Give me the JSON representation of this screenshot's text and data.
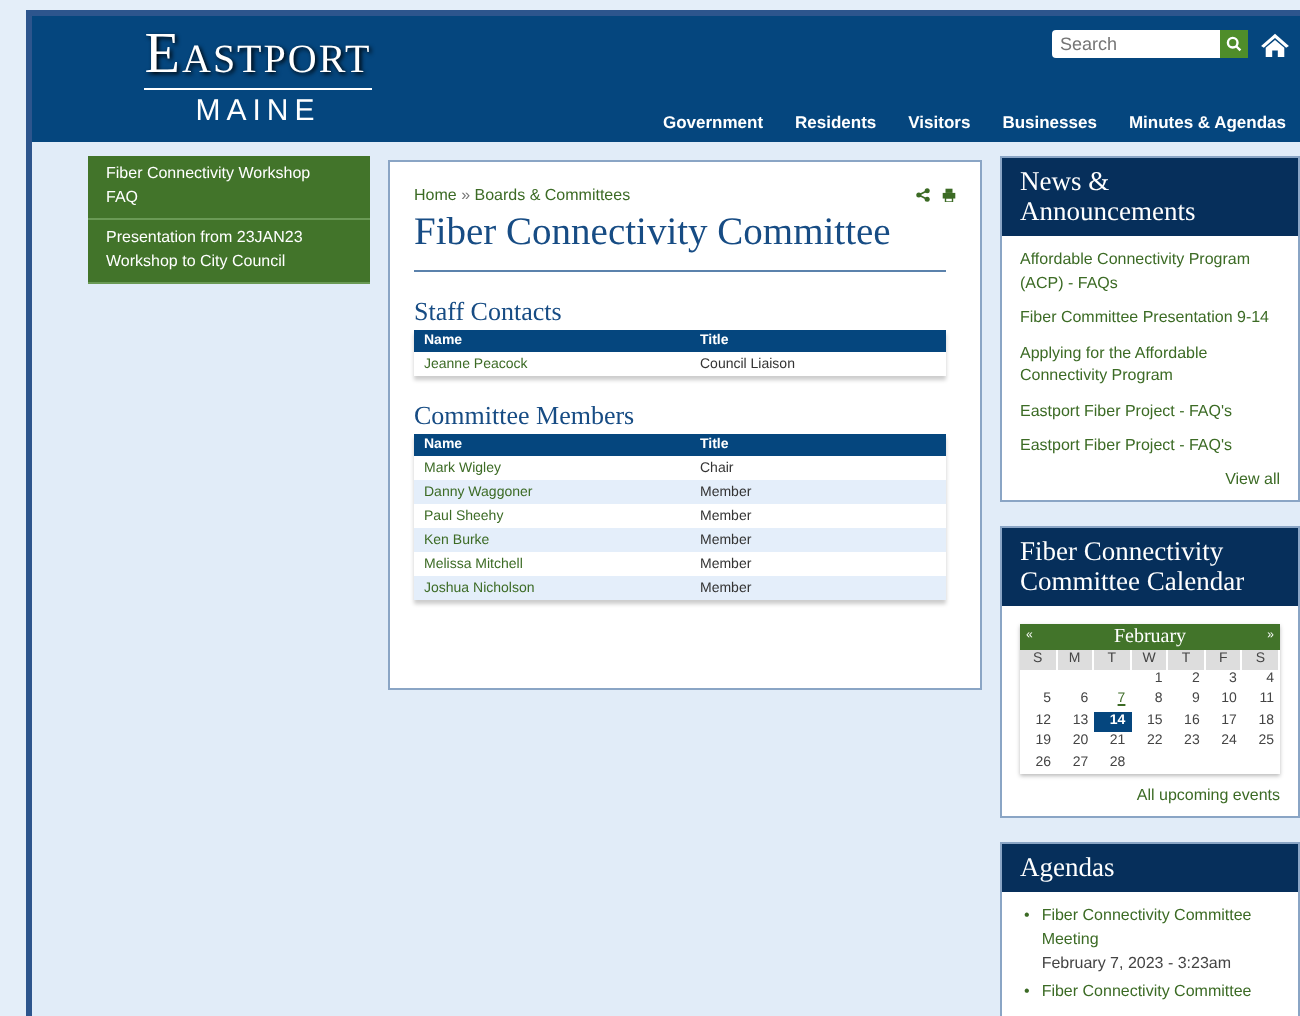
{
  "header": {
    "logo_top": "Eastport",
    "logo_bottom": "MAINE",
    "search": {
      "placeholder": "Search"
    },
    "nav": [
      "Government",
      "Residents",
      "Visitors",
      "Businesses",
      "Minutes & Agendas"
    ]
  },
  "sidebar": {
    "items": [
      {
        "label": "Fiber Connectivity Workshop FAQ"
      },
      {
        "label": "Presentation from 23JAN23 Workshop to City Council"
      }
    ]
  },
  "main": {
    "breadcrumb": [
      "Home",
      "Boards & Committees"
    ],
    "breadcrumb_separator": "»",
    "title": "Fiber Connectivity Committee",
    "sections": [
      {
        "heading": "Staff Contacts",
        "columns": [
          "Name",
          "Title"
        ],
        "rows": [
          {
            "name": "Jeanne Peacock",
            "title": "Council Liaison"
          }
        ]
      },
      {
        "heading": "Committee Members",
        "columns": [
          "Name",
          "Title"
        ],
        "rows": [
          {
            "name": "Mark Wigley",
            "title": "Chair"
          },
          {
            "name": "Danny Waggoner",
            "title": "Member"
          },
          {
            "name": "Paul Sheehy",
            "title": "Member"
          },
          {
            "name": "Ken Burke",
            "title": "Member"
          },
          {
            "name": "Melissa Mitchell",
            "title": "Member"
          },
          {
            "name": "Joshua Nicholson",
            "title": "Member"
          }
        ]
      }
    ]
  },
  "news": {
    "title": "News & Announcements",
    "items": [
      "Affordable Connectivity Program (ACP) - FAQs",
      "Fiber Committee Presentation 9-14",
      "Applying for the Affordable Connectivity Program",
      "Eastport Fiber Project - FAQ's",
      "Eastport Fiber Project - FAQ's"
    ],
    "more": "View all"
  },
  "calendar": {
    "title": "Fiber Connectivity Committee Calendar",
    "month": "February",
    "prev": "«",
    "next": "»",
    "weekdays": [
      "S",
      "M",
      "T",
      "W",
      "T",
      "F",
      "S"
    ],
    "weeks": [
      [
        {
          "kind": "blank"
        },
        {
          "kind": "blank"
        },
        {
          "kind": "blank"
        },
        {
          "kind": "day",
          "day": "1",
          "selected": false,
          "event": false
        },
        {
          "kind": "day",
          "day": "2",
          "selected": false,
          "event": false
        },
        {
          "kind": "day",
          "day": "3",
          "selected": false,
          "event": false
        },
        {
          "kind": "day",
          "day": "4",
          "selected": false,
          "event": false
        }
      ],
      [
        {
          "kind": "day",
          "day": "5",
          "selected": false,
          "event": false
        },
        {
          "kind": "day",
          "day": "6",
          "selected": false,
          "event": false
        },
        {
          "kind": "day",
          "day": "7",
          "selected": false,
          "event": true
        },
        {
          "kind": "day",
          "day": "8",
          "selected": false,
          "event": false
        },
        {
          "kind": "day",
          "day": "9",
          "selected": false,
          "event": false
        },
        {
          "kind": "day",
          "day": "10",
          "selected": false,
          "event": false
        },
        {
          "kind": "day",
          "day": "11",
          "selected": false,
          "event": false
        }
      ],
      [
        {
          "kind": "day",
          "day": "12",
          "selected": false,
          "event": false
        },
        {
          "kind": "day",
          "day": "13",
          "selected": false,
          "event": false
        },
        {
          "kind": "day",
          "day": "14",
          "selected": true,
          "event": false
        },
        {
          "kind": "day",
          "day": "15",
          "selected": false,
          "event": false
        },
        {
          "kind": "day",
          "day": "16",
          "selected": false,
          "event": false
        },
        {
          "kind": "day",
          "day": "17",
          "selected": false,
          "event": false
        },
        {
          "kind": "day",
          "day": "18",
          "selected": false,
          "event": false
        }
      ],
      [
        {
          "kind": "day",
          "day": "19",
          "selected": false,
          "event": false
        },
        {
          "kind": "day",
          "day": "20",
          "selected": false,
          "event": false
        },
        {
          "kind": "day",
          "day": "21",
          "selected": false,
          "event": false
        },
        {
          "kind": "day",
          "day": "22",
          "selected": false,
          "event": false
        },
        {
          "kind": "day",
          "day": "23",
          "selected": false,
          "event": false
        },
        {
          "kind": "day",
          "day": "24",
          "selected": false,
          "event": false
        },
        {
          "kind": "day",
          "day": "25",
          "selected": false,
          "event": false
        }
      ],
      [
        {
          "kind": "day",
          "day": "26",
          "selected": false,
          "event": false
        },
        {
          "kind": "day",
          "day": "27",
          "selected": false,
          "event": false
        },
        {
          "kind": "day",
          "day": "28",
          "selected": false,
          "event": false
        },
        {
          "kind": "blank"
        },
        {
          "kind": "blank"
        },
        {
          "kind": "blank"
        },
        {
          "kind": "blank"
        }
      ]
    ],
    "more": "All upcoming events"
  },
  "agendas": {
    "title": "Agendas",
    "bullet": "•",
    "items": [
      {
        "title": "Fiber Connectivity Committee Meeting",
        "date": "February 7, 2023 - 3:23am"
      },
      {
        "title": "Fiber Connectivity Committee"
      }
    ]
  }
}
